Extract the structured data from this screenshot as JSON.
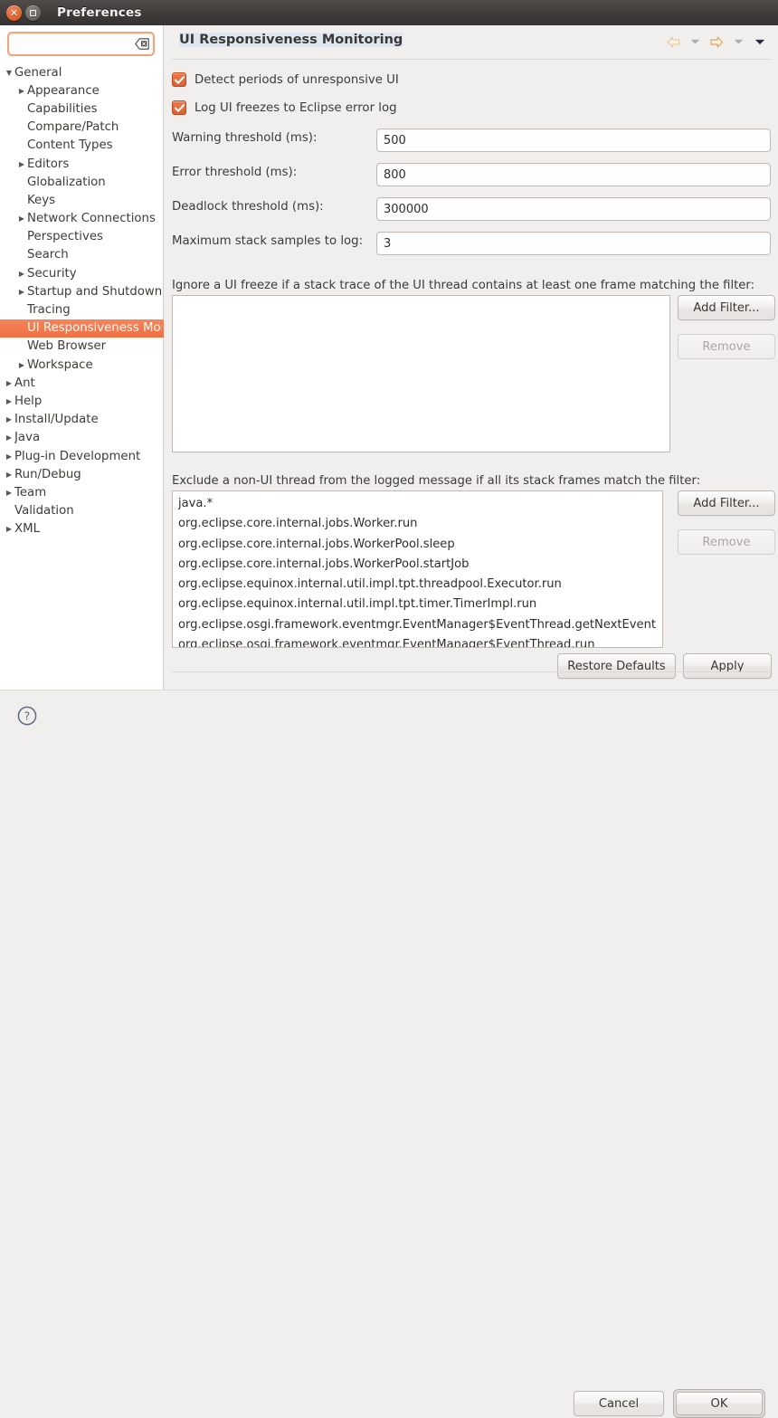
{
  "window": {
    "title": "Preferences",
    "close_icon": "close-icon",
    "restore_icon": "restore-icon"
  },
  "search": {
    "value": "",
    "placeholder": "",
    "clear_icon": "clear-field-icon"
  },
  "sidebar": {
    "items": [
      {
        "label": "General",
        "indent": 0,
        "twisty": "expanded",
        "selected": false
      },
      {
        "label": "Appearance",
        "indent": 1,
        "twisty": "collapsed",
        "selected": false
      },
      {
        "label": "Capabilities",
        "indent": 1,
        "twisty": "none",
        "selected": false
      },
      {
        "label": "Compare/Patch",
        "indent": 1,
        "twisty": "none",
        "selected": false
      },
      {
        "label": "Content Types",
        "indent": 1,
        "twisty": "none",
        "selected": false
      },
      {
        "label": "Editors",
        "indent": 1,
        "twisty": "collapsed",
        "selected": false
      },
      {
        "label": "Globalization",
        "indent": 1,
        "twisty": "none",
        "selected": false
      },
      {
        "label": "Keys",
        "indent": 1,
        "twisty": "none",
        "selected": false
      },
      {
        "label": "Network Connections",
        "indent": 1,
        "twisty": "collapsed",
        "selected": false
      },
      {
        "label": "Perspectives",
        "indent": 1,
        "twisty": "none",
        "selected": false
      },
      {
        "label": "Search",
        "indent": 1,
        "twisty": "none",
        "selected": false
      },
      {
        "label": "Security",
        "indent": 1,
        "twisty": "collapsed",
        "selected": false
      },
      {
        "label": "Startup and Shutdown",
        "indent": 1,
        "twisty": "collapsed",
        "selected": false
      },
      {
        "label": "Tracing",
        "indent": 1,
        "twisty": "none",
        "selected": false
      },
      {
        "label": "UI Responsiveness Monitoring",
        "indent": 1,
        "twisty": "none",
        "selected": true
      },
      {
        "label": "Web Browser",
        "indent": 1,
        "twisty": "none",
        "selected": false
      },
      {
        "label": "Workspace",
        "indent": 1,
        "twisty": "collapsed",
        "selected": false
      },
      {
        "label": "Ant",
        "indent": 0,
        "twisty": "collapsed",
        "selected": false
      },
      {
        "label": "Help",
        "indent": 0,
        "twisty": "collapsed",
        "selected": false
      },
      {
        "label": "Install/Update",
        "indent": 0,
        "twisty": "collapsed",
        "selected": false
      },
      {
        "label": "Java",
        "indent": 0,
        "twisty": "collapsed",
        "selected": false
      },
      {
        "label": "Plug-in Development",
        "indent": 0,
        "twisty": "collapsed",
        "selected": false
      },
      {
        "label": "Run/Debug",
        "indent": 0,
        "twisty": "collapsed",
        "selected": false
      },
      {
        "label": "Team",
        "indent": 0,
        "twisty": "collapsed",
        "selected": false
      },
      {
        "label": "Validation",
        "indent": 0,
        "twisty": "none",
        "selected": false
      },
      {
        "label": "XML",
        "indent": 0,
        "twisty": "collapsed",
        "selected": false
      }
    ]
  },
  "page": {
    "title": "UI Responsiveness Monitoring",
    "nav": {
      "back_icon": "back-arrow-icon",
      "back_menu_icon": "chevron-down-icon",
      "forward_icon": "forward-arrow-icon",
      "forward_menu_icon": "chevron-down-icon",
      "view_menu_icon": "chevron-down-icon"
    },
    "checkboxes": [
      {
        "label": "Detect periods of unresponsive UI",
        "checked": true
      },
      {
        "label": "Log UI freezes to Eclipse error log",
        "checked": true
      }
    ],
    "fields": [
      {
        "label": "Warning threshold (ms):",
        "value": "500"
      },
      {
        "label": "Error threshold (ms):",
        "value": "800"
      },
      {
        "label": "Deadlock threshold (ms):",
        "value": "300000"
      },
      {
        "label": "Maximum stack samples to log:",
        "value": "3"
      }
    ],
    "ignore_section": {
      "label": "Ignore a UI freeze if a stack trace of the UI thread contains at least one frame matching the filter:",
      "items": [],
      "add_button": "Add Filter...",
      "remove_button": "Remove",
      "remove_enabled": false
    },
    "exclude_section": {
      "label": "Exclude a non-UI thread from the logged message if all its stack frames match the filter:",
      "items": [
        "java.*",
        "org.eclipse.core.internal.jobs.Worker.run",
        "org.eclipse.core.internal.jobs.WorkerPool.sleep",
        "org.eclipse.core.internal.jobs.WorkerPool.startJob",
        "org.eclipse.equinox.internal.util.impl.tpt.threadpool.Executor.run",
        "org.eclipse.equinox.internal.util.impl.tpt.timer.TimerImpl.run",
        "org.eclipse.osgi.framework.eventmgr.EventManager$EventThread.getNextEvent",
        "org.eclipse.osgi.framework.eventmgr.EventManager$EventThread.run"
      ],
      "add_button": "Add Filter...",
      "remove_button": "Remove",
      "remove_enabled": false
    },
    "restore_defaults_button": "Restore Defaults",
    "apply_button": "Apply"
  },
  "footer": {
    "help_icon": "help-icon",
    "cancel_button": "Cancel",
    "ok_button": "OK"
  },
  "colors": {
    "selection": "#ef6f41",
    "checkbox": "#dd5f30",
    "panel_bg": "#f0efee",
    "titlebar": "#3f3b38"
  }
}
